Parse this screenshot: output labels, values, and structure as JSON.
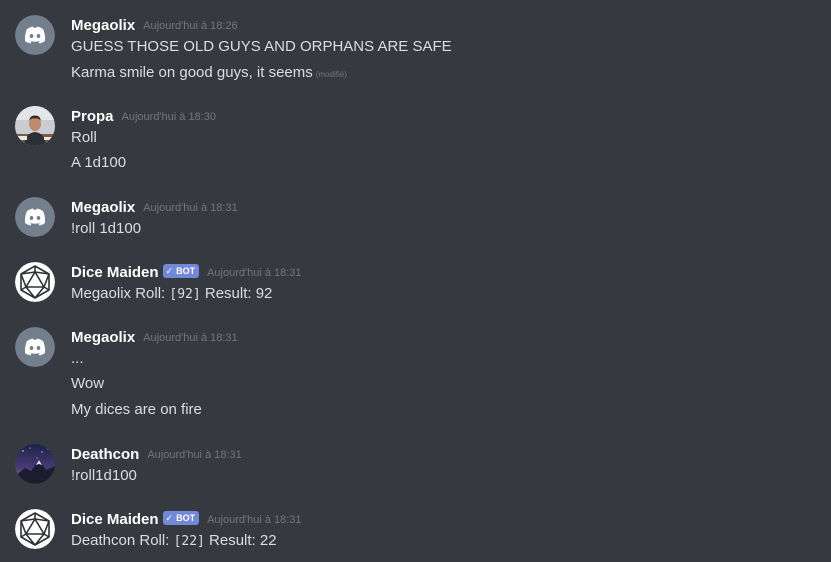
{
  "messages": [
    {
      "author": "Megaolix",
      "avatar": "discord-logo-avatar",
      "timestamp": "Aujourd'hui à 18:26",
      "lines": [
        "GUESS THOSE OLD GUYS AND ORPHANS ARE SAFE",
        "Karma smile on good guys, it seems"
      ],
      "edited_label": "(modifié)"
    },
    {
      "author": "Propa",
      "avatar": "photo-avatar",
      "timestamp": "Aujourd'hui à 18:30",
      "lines": [
        "Roll",
        "A 1d100"
      ]
    },
    {
      "author": "Megaolix",
      "avatar": "discord-logo-avatar",
      "timestamp": "Aujourd'hui à 18:31",
      "lines": [
        "!roll 1d100"
      ]
    },
    {
      "author": "Dice Maiden",
      "avatar": "d20-avatar",
      "bot_tag": "BOT",
      "timestamp": "Aujourd'hui à 18:31",
      "roll": {
        "prefix": "Megaolix Roll: ",
        "code": "[92]",
        "suffix": " Result: 92"
      }
    },
    {
      "author": "Megaolix",
      "avatar": "discord-logo-avatar",
      "timestamp": "Aujourd'hui à 18:31",
      "lines": [
        "...",
        "Wow",
        "My dices are on fire"
      ]
    },
    {
      "author": "Deathcon",
      "avatar": "night-sky-avatar",
      "timestamp": "Aujourd'hui à 18:31",
      "lines": [
        "!roll1d100"
      ]
    },
    {
      "author": "Dice Maiden",
      "avatar": "d20-avatar",
      "bot_tag": "BOT",
      "timestamp": "Aujourd'hui à 18:31",
      "roll": {
        "prefix": "Deathcon Roll: ",
        "code": "[22]",
        "suffix": " Result: 22"
      }
    }
  ],
  "colors": {
    "background": "#36393f",
    "username": "#ffffff",
    "text": "#dcddde",
    "timestamp": "#72767d",
    "bot_tag": "#7289da",
    "discord_avatar": "#747f8d"
  }
}
